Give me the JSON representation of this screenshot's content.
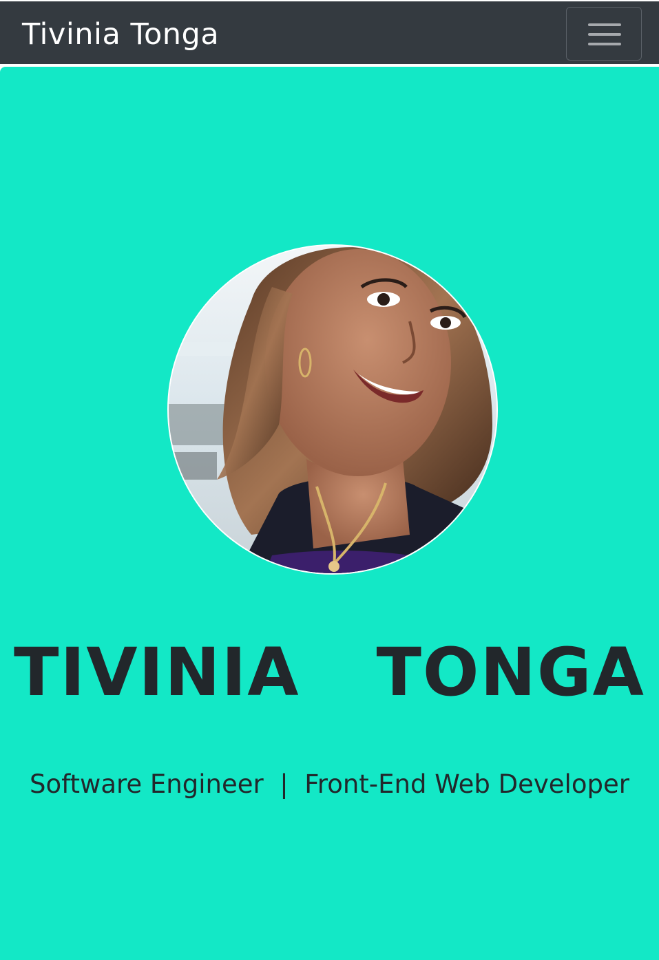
{
  "navbar": {
    "brand": "Tivinia Tonga",
    "toggler_icon": "hamburger-menu-icon",
    "background": "#343a40"
  },
  "hero": {
    "background": "#13e8c6",
    "photo_alt": "Profile photo of Tivinia Tonga",
    "name": "TIVINIA  TONGA",
    "tagline": "Software Engineer  |  Front-End Web Developer"
  }
}
